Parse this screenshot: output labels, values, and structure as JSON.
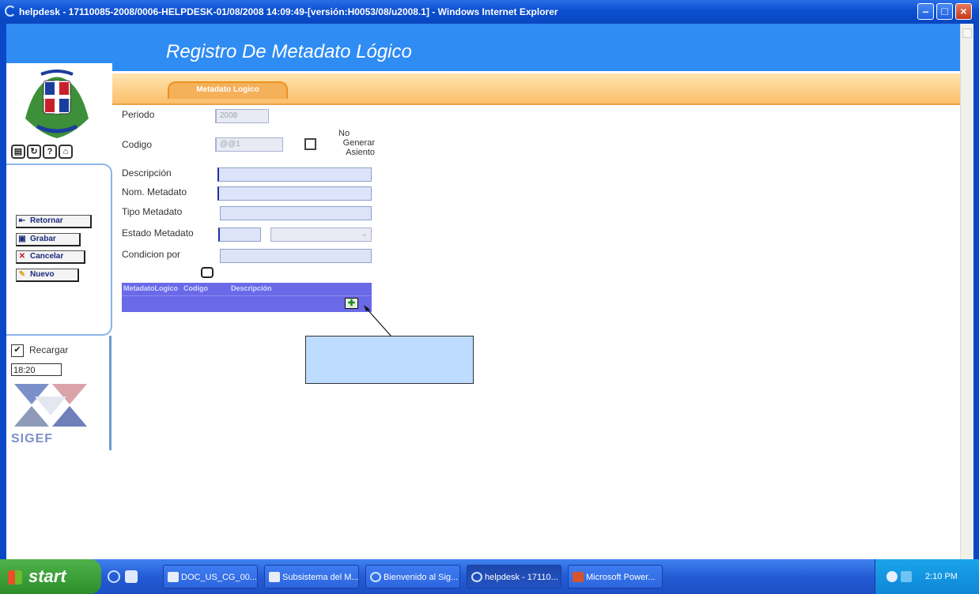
{
  "window": {
    "title": "helpdesk - 17110085-2008/0006-HELPDESK-01/08/2008 14:09:49-[versión:H0053/08/u2008.1] - Windows Internet Explorer"
  },
  "header": {
    "title": "Registro De Metadato Lógico"
  },
  "tabs": [
    {
      "label": "Metadato Logico"
    }
  ],
  "sidebar": {
    "buttons": [
      {
        "label": "Retornar",
        "icon": "return-icon"
      },
      {
        "label": "Grabar",
        "icon": "save-icon"
      },
      {
        "label": "Cancelar",
        "icon": "cancel-icon"
      },
      {
        "label": "Nuevo",
        "icon": "pencil-icon"
      }
    ],
    "recargar": {
      "label": "Recargar",
      "checked": true
    },
    "time": "18:20",
    "logo_text": "SIGEF"
  },
  "form": {
    "periodo": {
      "label": "Periodo",
      "value": "2008"
    },
    "codigo": {
      "label": "Codigo",
      "value": "@@1"
    },
    "no_generar": {
      "label": "No Generar Asiento",
      "checked": false
    },
    "descripcion": {
      "label": "Descripción",
      "value": ""
    },
    "nom_metadato": {
      "label": "Nom. Metadato",
      "value": ""
    },
    "tipo_metadato": {
      "label": "Tipo Metadato",
      "value": ""
    },
    "estado_metadato": {
      "label": "Estado Metadato",
      "value": ""
    },
    "condicion_por": {
      "label": "Condicion por",
      "value": ""
    }
  },
  "grid": {
    "columns": [
      "MetadatoLogico",
      "Codigo",
      "Descripción"
    ]
  },
  "taskbar": {
    "start": "start",
    "items": [
      {
        "label": "DOC_US_CG_00...",
        "active": false
      },
      {
        "label": "Subsistema del M...",
        "active": false
      },
      {
        "label": "Bienvenido al Sig...",
        "active": false
      },
      {
        "label": "helpdesk - 17110...",
        "active": true
      },
      {
        "label": "Microsoft Power...",
        "active": false
      }
    ],
    "clock": "2:10 PM"
  },
  "colors": {
    "header_blue": "#2f8cf3",
    "tab_orange": "#f5b05a",
    "grid_purple": "#6a69e8",
    "callout": "#bedcff"
  }
}
